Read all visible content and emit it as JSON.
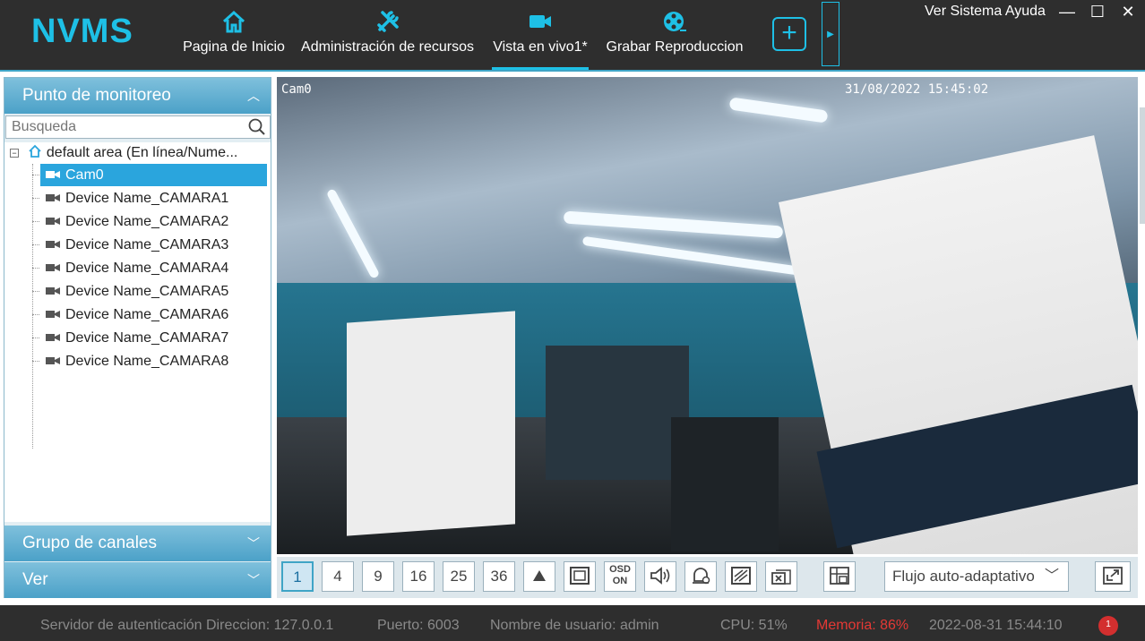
{
  "app": {
    "logo": "NVMS"
  },
  "nav": {
    "items": [
      {
        "label": "Pagina de Inicio",
        "icon": "home-icon"
      },
      {
        "label": "Administración de recursos",
        "icon": "tools-icon"
      },
      {
        "label": "Vista en vivo1*",
        "icon": "video-camera-icon",
        "active": true
      },
      {
        "label": "Grabar Reproduccion",
        "icon": "film-reel-icon"
      }
    ],
    "add_tab": "+"
  },
  "top_menu": {
    "text": "Ver Sistema Ayuda"
  },
  "window_controls": {
    "minimize": "—",
    "maximize": "☐",
    "close": "✕"
  },
  "left_panel": {
    "monitor_point": "Punto de monitoreo",
    "search_placeholder": "Busqueda",
    "tree": {
      "root": "default area (En línea/Nume...",
      "cameras": [
        {
          "label": "Cam0",
          "selected": true
        },
        {
          "label": "Device Name_CAMARA1"
        },
        {
          "label": "Device Name_CAMARA2"
        },
        {
          "label": "Device Name_CAMARA3"
        },
        {
          "label": "Device Name_CAMARA4"
        },
        {
          "label": "Device Name_CAMARA5"
        },
        {
          "label": "Device Name_CAMARA6"
        },
        {
          "label": "Device Name_CAMARA7"
        },
        {
          "label": "Device Name_CAMARA8"
        }
      ]
    },
    "channel_group": "Grupo de canales",
    "view": "Ver"
  },
  "video": {
    "camera_name": "Cam0",
    "timestamp": "31/08/2022 15:45:02"
  },
  "toolbar": {
    "layouts": [
      "1",
      "4",
      "9",
      "16",
      "25",
      "36"
    ],
    "osd_line1": "OSD",
    "osd_line2": "ON",
    "stream_mode": "Flujo auto-adaptativo"
  },
  "status": {
    "auth_server": "Servidor de autenticación Direccion: 127.0.0.1",
    "port": "Puerto: 6003",
    "user": "Nombre de usuario: admin",
    "cpu": "CPU: 51%",
    "memory": "Memoria: 86%",
    "datetime": "2022-08-31 15:44:10",
    "alarm_count": "1"
  },
  "colors": {
    "accent": "#1ec0e6",
    "panel_header": "#4ba1c8",
    "selected": "#2aa5dd",
    "warning": "#e53935"
  }
}
